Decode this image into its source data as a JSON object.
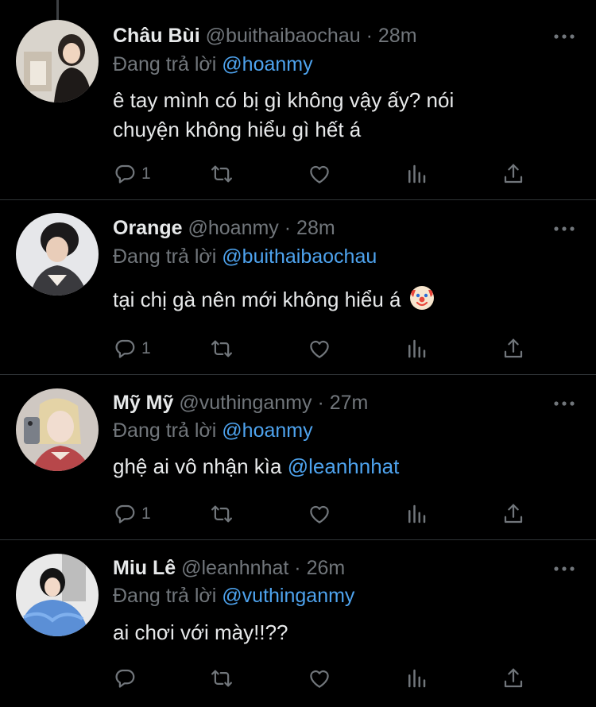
{
  "tweets": [
    {
      "name": "Châu Bùi",
      "handle": "@buithaibaochau",
      "time": "28m",
      "reply_prefix": "Đang trả lời",
      "reply_to": "@hoanmy",
      "text_lines": [
        "ê tay mình có bị gì không vậy ấy?  nói",
        "chuyện không hiểu gì hết á"
      ],
      "reply_count": "1"
    },
    {
      "name": "Orange",
      "handle": "@hoanmy",
      "time": "28m",
      "reply_prefix": "Đang trả lời",
      "reply_to": "@buithaibaochau",
      "text": "tại chị gà nên mới không hiểu á",
      "emoji": "clown-face",
      "reply_count": "1"
    },
    {
      "name": "Mỹ Mỹ",
      "handle": "@vuthinganmy",
      "time": "27m",
      "reply_prefix": "Đang trả lời",
      "reply_to": "@hoanmy",
      "text": "ghệ ai vô nhận kìa",
      "mention": "@leanhnhat",
      "reply_count": "1"
    },
    {
      "name": "Miu Lê",
      "handle": "@leanhnhat",
      "time": "26m",
      "reply_prefix": "Đang trả lời",
      "reply_to": "@vuthinganmy",
      "text": "ai chơi với mày!!??",
      "reply_count": ""
    }
  ],
  "separator": "·",
  "icons": [
    "reply-icon",
    "retweet-icon",
    "like-icon",
    "analytics-icon",
    "share-icon",
    "more-icon"
  ],
  "colors": {
    "background": "#000000",
    "text": "#e7e9ea",
    "muted": "#71767b",
    "link": "#4ea3ee"
  }
}
